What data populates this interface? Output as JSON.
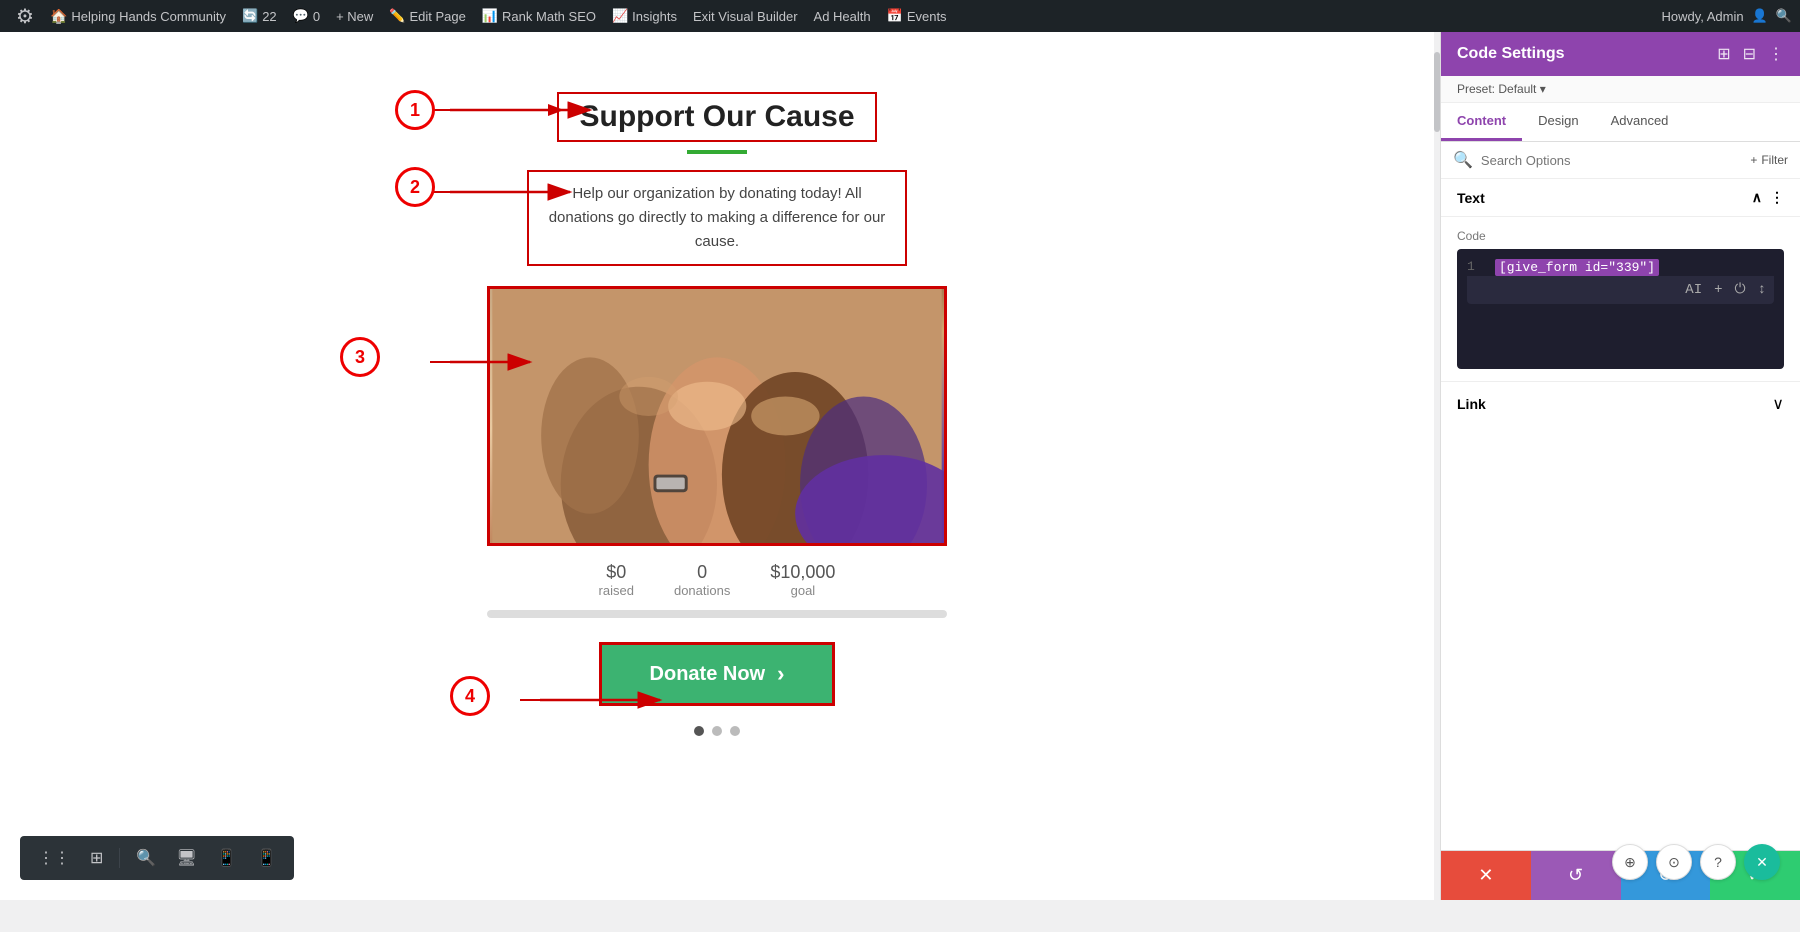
{
  "adminBar": {
    "siteIcon": "⚙",
    "siteName": "Helping Hands Community",
    "updates": "22",
    "comments": "0",
    "newLabel": "+ New",
    "editPage": "Edit Page",
    "rankMath": "Rank Math SEO",
    "insights": "Insights",
    "exitBuilder": "Exit Visual Builder",
    "adHealth": "Ad Health",
    "events": "Events",
    "howdy": "Howdy, Admin"
  },
  "canvas": {
    "sectionTitle": "Support Our Cause",
    "sectionDescription": "Help our organization by donating today! All donations go directly to making a difference for our cause.",
    "stats": [
      {
        "value": "$0",
        "label": "raised"
      },
      {
        "value": "0",
        "label": "donations"
      },
      {
        "value": "$10,000",
        "label": "goal"
      }
    ],
    "donateButton": "Donate Now",
    "donateChevron": "›"
  },
  "annotations": [
    {
      "num": "1"
    },
    {
      "num": "2"
    },
    {
      "num": "3"
    },
    {
      "num": "4"
    }
  ],
  "settingsPanel": {
    "title": "Code Settings",
    "preset": "Preset: Default",
    "tabs": [
      "Content",
      "Design",
      "Advanced"
    ],
    "activeTab": "Content",
    "searchPlaceholder": "Search Options",
    "filterLabel": "+ Filter",
    "textSectionLabel": "Text",
    "codeLabel": "Code",
    "codeValue": "[give_form id=\"339\"]",
    "lineNum": "1",
    "linkLabel": "Link",
    "actions": {
      "close": "✕",
      "undo": "↺",
      "redo": "↻",
      "check": "✓"
    }
  },
  "bottomToolbar": {
    "items": [
      "⋮⋮",
      "⊞",
      "🔍",
      "🖥",
      "📱",
      "📱"
    ]
  },
  "bottomRight": {
    "buttons": [
      "⊕",
      "⊙",
      "?",
      "✕"
    ]
  },
  "pagination": {
    "dots": [
      true,
      false,
      false
    ]
  }
}
